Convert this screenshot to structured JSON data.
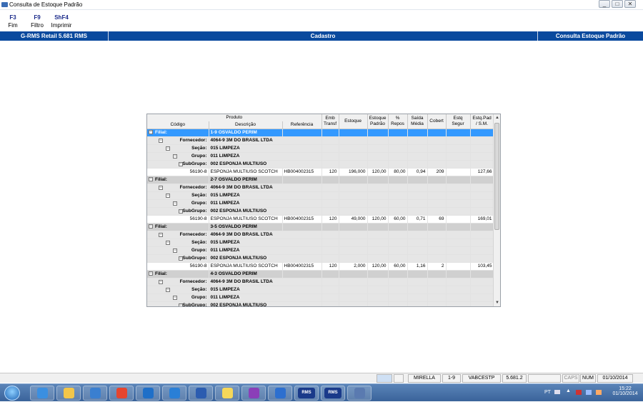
{
  "window": {
    "title": "Consulta de Estoque Padrão",
    "btn_min": "_",
    "btn_max": "□",
    "btn_close": "✕"
  },
  "fkeys": [
    {
      "key": "F3",
      "label": "Fim"
    },
    {
      "key": "F9",
      "label": "Filtro"
    },
    {
      "key": "ShF4",
      "label": "Imprimir"
    }
  ],
  "bluebar": {
    "app": "G-RMS Retail 5.681 RMS",
    "module": "Cadastro",
    "screen": "Consulta Estoque Padrão"
  },
  "grid": {
    "headers": {
      "produto": "Produto",
      "codigo": "Código",
      "descricao": "Descrição",
      "referencia": "Referência",
      "emb1": "Emb",
      "emb2": "Transf",
      "estoque": "Estoque",
      "estpad1": "Estoque",
      "estpad2": "Padrão",
      "pct1": "%",
      "pct2": "Repos",
      "saida1": "Saída",
      "saida2": "Média",
      "cobert": "Cobert",
      "seg1": "Estq",
      "seg2": "Segur",
      "sm1": "Estq.Pad",
      "sm2": "/ S.M."
    },
    "labels": {
      "filial": "Filial:",
      "fornecedor": "Fornecedor:",
      "secao": "Seção:",
      "grupo": "Grupo:",
      "subgrupo": "SubGrupo:"
    },
    "groups": [
      {
        "filial": "1-9 OSVALDO PERIM",
        "fornecedor": "4064-9 3M DO BRASIL LTDA",
        "secao": "015 LIMPEZA",
        "grupo": "011 LIMPEZA",
        "subgrupo": "002 ESPONJA MULTIUSO",
        "item": {
          "codigo": "56190-8",
          "descricao": "ESPONJA MULTIUSO SCOTCH",
          "referencia": "HB004002315",
          "emb": "120",
          "estoque": "196,000",
          "estpad": "120,00",
          "pct": "80,00",
          "saida": "0,94",
          "cobert": "209",
          "segur": "",
          "sm": "127,66"
        }
      },
      {
        "filial": "2-7 OSVALDO PERIM",
        "fornecedor": "4064-9 3M DO BRASIL LTDA",
        "secao": "015 LIMPEZA",
        "grupo": "011 LIMPEZA",
        "subgrupo": "002 ESPONJA MULTIUSO",
        "item": {
          "codigo": "56190-8",
          "descricao": "ESPONJA MULTIUSO SCOTCH",
          "referencia": "HB004002315",
          "emb": "120",
          "estoque": "49,000",
          "estpad": "120,00",
          "pct": "60,00",
          "saida": "0,71",
          "cobert": "69",
          "segur": "",
          "sm": "169,01"
        }
      },
      {
        "filial": "3-5 OSVALDO PERIM",
        "fornecedor": "4064-9 3M DO BRASIL LTDA",
        "secao": "015 LIMPEZA",
        "grupo": "011 LIMPEZA",
        "subgrupo": "002 ESPONJA MULTIUSO",
        "item": {
          "codigo": "56190-8",
          "descricao": "ESPONJA MULTIUSO SCOTCH",
          "referencia": "HB004002315",
          "emb": "120",
          "estoque": "2,000",
          "estpad": "120,00",
          "pct": "60,00",
          "saida": "1,16",
          "cobert": "2",
          "segur": "",
          "sm": "103,45"
        }
      },
      {
        "filial": "4-3 OSVALDO PERIM",
        "fornecedor": "4064-9 3M DO BRASIL LTDA",
        "secao": "015 LIMPEZA",
        "grupo": "011 LIMPEZA",
        "subgrupo": "002 ESPONJA MULTIUSO"
      }
    ]
  },
  "statusbar": {
    "user": "MIRELLA",
    "filial": "1-9",
    "program": "VABCESTP",
    "version": "5.681.2",
    "caps": "CAPS",
    "num": "NUM",
    "date": "01/10/2014"
  },
  "taskbar": {
    "lang": "PT",
    "time": "15:22",
    "date": "01/10/2014",
    "apps": [
      "ie-icon",
      "explorer-icon",
      "media-icon",
      "chrome-icon",
      "outlook-icon",
      "lync-icon",
      "word-icon",
      "folder-icon",
      "mirror-icon",
      "network-icon",
      "rms-icon",
      "rms-icon",
      "paint-icon"
    ],
    "rms1": "RMS",
    "rms2": "RMS"
  }
}
